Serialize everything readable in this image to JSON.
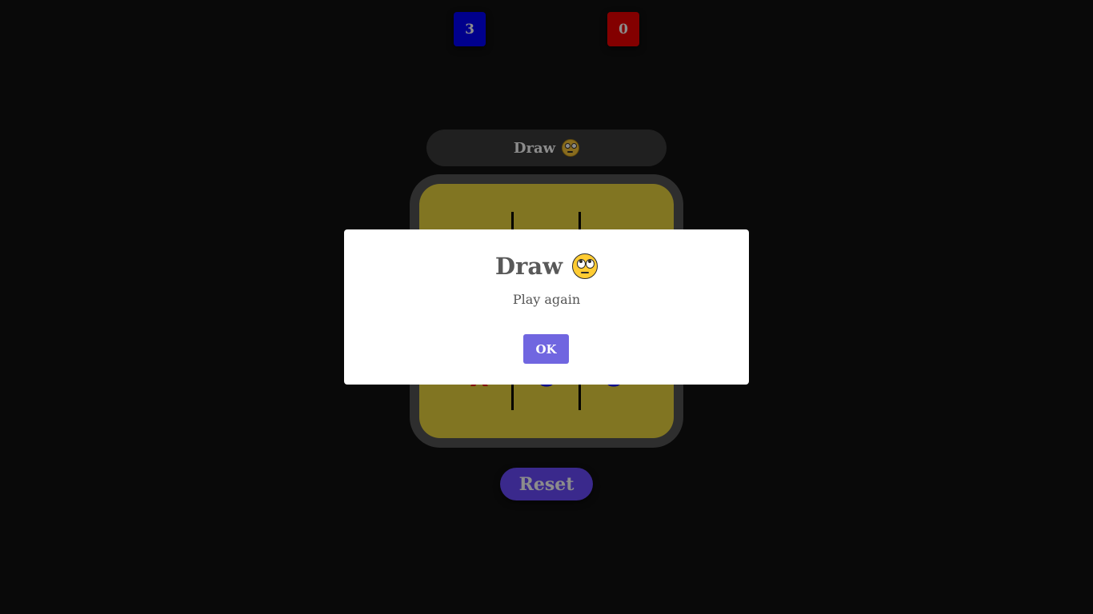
{
  "scores": {
    "player_o": "3",
    "player_x": "0"
  },
  "colors": {
    "player_o": "#0000ff",
    "player_x": "#ee0000",
    "board": "#ecd53f",
    "reset": "#6a4cff",
    "ok": "#7066e0"
  },
  "status": {
    "text": "Draw",
    "emoji": "face-with-rolling-eyes-icon"
  },
  "board": {
    "cells": [
      "",
      "",
      "",
      "",
      "",
      "",
      "X",
      "O",
      "O"
    ]
  },
  "reset_label": "Reset",
  "modal": {
    "title": "Draw",
    "emoji": "face-with-rolling-eyes-icon",
    "text": "Play again",
    "ok_label": "OK"
  }
}
